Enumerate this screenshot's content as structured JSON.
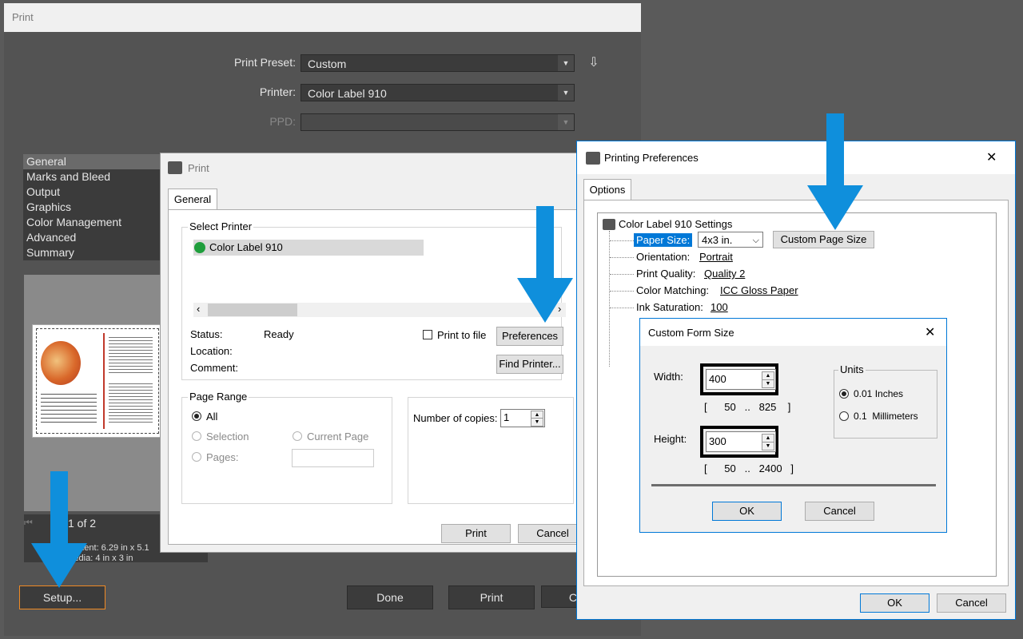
{
  "ai": {
    "title": "Print",
    "print_preset_label": "Print Preset:",
    "print_preset_value": "Custom",
    "printer_label": "Printer:",
    "printer_value": "Color Label 910",
    "ppd_label": "PPD:",
    "ppd_value": "",
    "categories": [
      "General",
      "Marks and Bleed",
      "Output",
      "Graphics",
      "Color Management",
      "Advanced",
      "Summary"
    ],
    "page_nav": "1 of 2",
    "document_info": "ument: 6.29 in x 5.1",
    "media_info": "ledia: 4 in x 3 in",
    "setup_label": "Setup...",
    "done_label": "Done",
    "print_label": "Print",
    "cancel_partial": "C"
  },
  "win_print": {
    "title": "Print",
    "tab": "General",
    "select_printer_label": "Select Printer",
    "printer_item": "Color Label 910",
    "status_label": "Status:",
    "status_value": "Ready",
    "location_label": "Location:",
    "comment_label": "Comment:",
    "print_to_file_label": "Print to file",
    "preferences_label": "Preferences",
    "find_printer_label": "Find Printer...",
    "page_range_label": "Page Range",
    "range_all": "All",
    "range_selection": "Selection",
    "range_current": "Current Page",
    "range_pages": "Pages:",
    "copies_label": "Number of copies:",
    "copies_value": "1",
    "print_button": "Print",
    "cancel_button": "Cancel"
  },
  "prefs": {
    "title": "Printing Preferences",
    "close_glyph": "✕",
    "tab": "Options",
    "root": "Color Label 910 Settings",
    "paper_size_label": "Paper Size:",
    "paper_size_value": "4x3 in.",
    "custom_page_size_label": "Custom Page Size",
    "orientation_label": "Orientation:",
    "orientation_value": "Portrait",
    "print_quality_label": "Print Quality:",
    "print_quality_value": "Quality 2",
    "color_matching_label": "Color Matching:",
    "color_matching_value": "ICC Gloss Paper",
    "ink_saturation_label": "Ink Saturation:",
    "ink_saturation_value": "100",
    "ok_label": "OK",
    "cancel_label": "Cancel"
  },
  "custom_form": {
    "title": "Custom Form Size",
    "close_glyph": "✕",
    "width_label": "Width:",
    "width_value": "400",
    "width_range": "[      50   ..   825    ]",
    "height_label": "Height:",
    "height_value": "300",
    "height_range": "[      50   ..   2400   ]",
    "units_label": "Units",
    "unit_inches": "0.01 Inches",
    "unit_mm": "0.1  Millimeters",
    "ok_label": "OK",
    "cancel_label": "Cancel"
  },
  "icons": {
    "printer": "printer-icon",
    "save_preset": "save-preset-icon",
    "close": "close-icon",
    "arrow": "down-arrow-annotation"
  },
  "colors": {
    "annotation_blue": "#0f8fdc",
    "ai_background": "#535353",
    "win_background": "#f0f0f0",
    "selection_blue": "#0078d7",
    "setup_highlight": "#f08a24"
  }
}
